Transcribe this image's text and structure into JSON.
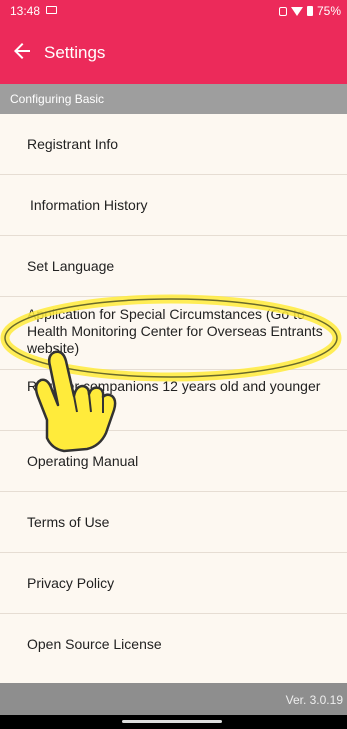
{
  "status": {
    "time": "13:48",
    "battery": "75%"
  },
  "header": {
    "title": "Settings"
  },
  "section": {
    "title": "Configuring Basic"
  },
  "items": [
    "Registrant Info",
    "Information History",
    "Set Language",
    "Application for Special Circumstances (Go to Health Monitoring Center for Overseas Entrants website)",
    "Register companions 12 years old and younger",
    "Operating Manual",
    "Terms of Use",
    "Privacy Policy",
    "Open Source License"
  ],
  "footer": {
    "version": "Ver. 3.0.19"
  },
  "colors": {
    "accent": "#ec2a5a",
    "highlight": "#ffeb3b"
  }
}
